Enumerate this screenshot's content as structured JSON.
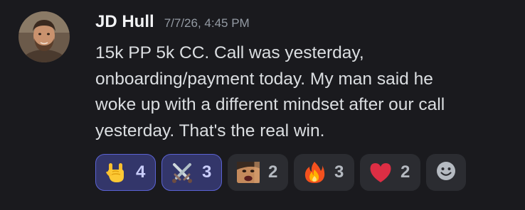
{
  "message": {
    "author": "JD Hull",
    "timestamp": "7/7/26, 4:45 PM",
    "lines": [
      "15k PP 5k CC. Call was yesterday,",
      "onboarding/payment today. My man said he",
      "woke up with a different mindset after our call",
      "yesterday. That's the real win."
    ]
  },
  "reactions": [
    {
      "icon": "rock-on-hand-icon",
      "count": "4",
      "selected": true
    },
    {
      "icon": "crossed-swords-icon",
      "count": "3",
      "selected": true
    },
    {
      "icon": "custom-face-emote-icon",
      "count": "2",
      "selected": false
    },
    {
      "icon": "fire-icon",
      "count": "3",
      "selected": false
    },
    {
      "icon": "red-heart-icon",
      "count": "2",
      "selected": false
    }
  ],
  "add_reaction": {
    "icon": "smiley-add-reaction-icon"
  },
  "colors": {
    "background": "#1a1a1e",
    "reaction_selected_bg": "#33366a",
    "reaction_selected_border": "#5b63d3",
    "reaction_bg": "#2b2c31"
  }
}
